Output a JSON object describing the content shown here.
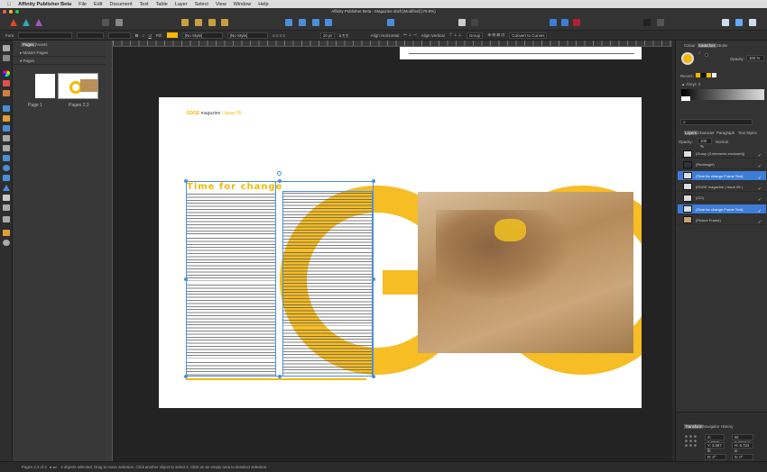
{
  "menubar": {
    "app": "Affinity Publisher Beta",
    "items": [
      "File",
      "Edit",
      "Document",
      "Text",
      "Table",
      "Layer",
      "Select",
      "View",
      "Window",
      "Help"
    ]
  },
  "window": {
    "title": "Affinity Publisher Beta - Magazine draft [Modified] (79.8%)"
  },
  "context": {
    "font_label": "Font",
    "fill_label": "Fill:",
    "fill_color": "#f5b800",
    "para_style": "[No Style]",
    "char_style": "[No Style]",
    "size": "10 pt",
    "align_h": "Align Horizontal",
    "align_v": "Align Vertical",
    "group": "Group",
    "convert": "Convert to Curves"
  },
  "pages_panel": {
    "tabs": [
      "Pages",
      "Assets"
    ],
    "master": "Master Pages",
    "pages": "Pages",
    "thumbs": [
      "Page 1",
      "Pages 2,3"
    ]
  },
  "document": {
    "brand": "EDGE",
    "magazine": "magazine",
    "issue": "| Issue 05",
    "headline": "Time for change",
    "big_letters": "GO",
    "accent": "#f5b800"
  },
  "right_panel": {
    "tabs": [
      "Colour",
      "Swatches",
      "Stroke"
    ],
    "opacity_label": "Opacity:",
    "opacity": "100 %",
    "recent": "Recent:",
    "palette": "Greys",
    "layers_tabs": [
      "Layers",
      "Character",
      "Paragraph",
      "Text Styles"
    ],
    "layer_opacity": "100 %",
    "blend": "Normal",
    "layers": [
      {
        "name": "(Group (3 elements enclosed))",
        "selected": false
      },
      {
        "name": "(Rectangle)",
        "selected": false
      },
      {
        "name": "(Time for change Frame Text)",
        "selected": true
      },
      {
        "name": "(EDGE magazine | Issue 05 )",
        "selected": false
      },
      {
        "name": "(GO)",
        "selected": false
      },
      {
        "name": "(Time for change Frame Text)",
        "selected": true
      },
      {
        "name": "(Picture Frame)",
        "selected": false
      }
    ],
    "transform_tabs": [
      "Transform",
      "Navigator",
      "History"
    ],
    "transform": {
      "x": "1.0008 in",
      "y": "3.067 in",
      "w": "8.6662 in",
      "h": "6.723 in",
      "r": "0°",
      "s": "0°"
    }
  },
  "status": {
    "pages": "Pages 2,3 of 3",
    "message": "2 objects selected. Drag to move selection. Click another object to select it. Click on an empty area to deselect selection."
  }
}
